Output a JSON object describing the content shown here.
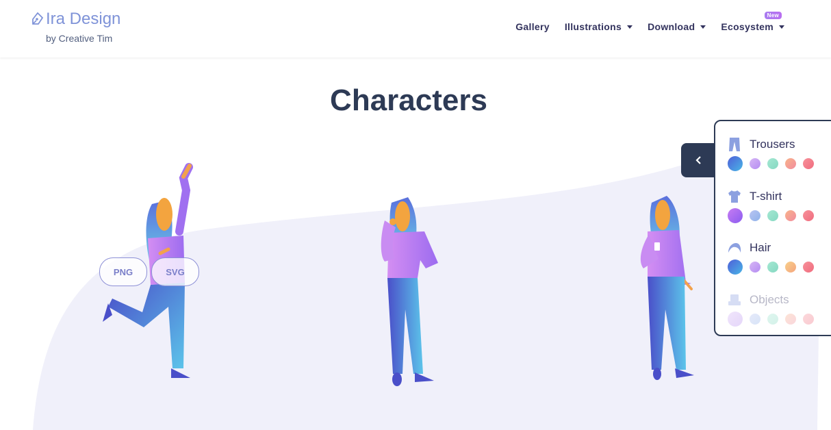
{
  "brand": {
    "title": "Ira Design",
    "subtitle": "by Creative Tim"
  },
  "nav": {
    "items": [
      {
        "label": "Gallery",
        "dropdown": false
      },
      {
        "label": "Illustrations",
        "dropdown": true
      },
      {
        "label": "Download",
        "dropdown": true
      },
      {
        "label": "Ecosystem",
        "dropdown": true,
        "badge": "New"
      }
    ]
  },
  "page": {
    "title": "Characters"
  },
  "download": {
    "png_label": "PNG",
    "svg_label": "SVG"
  },
  "panel": {
    "toggle_icon": "chevron-left-icon",
    "groups": [
      {
        "label": "Trousers",
        "icon": "trousers-icon",
        "colors": [
          "#3a8fd8",
          "#c9a7f2",
          "#9fe0c9",
          "#f7a5a0",
          "#f27c8a"
        ]
      },
      {
        "label": "T-shirt",
        "icon": "tshirt-icon",
        "colors": [
          "#9b6cf0",
          "#9ab4ea",
          "#9fe0c9",
          "#f7a5a0",
          "#f27c8a"
        ]
      },
      {
        "label": "Hair",
        "icon": "hair-icon",
        "colors": [
          "#3a8fd8",
          "#c9a7f2",
          "#9fe0c9",
          "#f5b88a",
          "#f27c8a"
        ]
      },
      {
        "label": "Objects",
        "icon": "objects-icon",
        "colors": [
          "#c9a7f2",
          "#b6cbf2",
          "#bff0df",
          "#f7c3c0",
          "#f7b3bd"
        ],
        "faded": true
      }
    ]
  },
  "colors": {
    "accent": "#7f93d8",
    "dark": "#2d3a55",
    "blob": "#f0f0fa"
  }
}
